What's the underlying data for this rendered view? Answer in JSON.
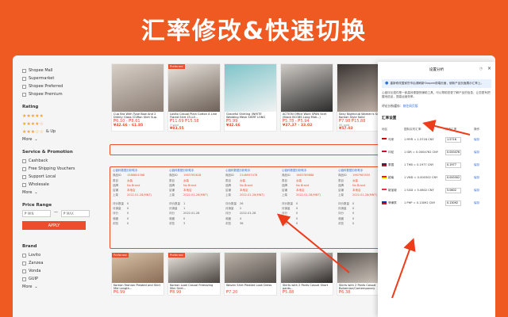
{
  "banner": {
    "title": "汇率修改&快速切换"
  },
  "sidebar": {
    "shops": [
      "Shopee Mall",
      "Supermarket",
      "Shopee Preferred",
      "Shopee Premium"
    ],
    "rating_title": "Rating",
    "rating_and_up": "& Up",
    "rating_more": "More",
    "service_title": "Service & Promotion",
    "services": [
      "Cashback",
      "Free Shipping Vouchers",
      "Support Local",
      "Wholesale"
    ],
    "service_more": "More",
    "price_title": "Price Range",
    "min_placeholder": "₱ MIN",
    "max_placeholder": "₱ MAX",
    "apply": "APPLY",
    "brand_title": "Brand",
    "brands": [
      "Lovito",
      "Zanzea",
      "Vonda",
      "GUIP"
    ],
    "brand_more": "More"
  },
  "products": [
    {
      "name": "Cup Bra With Type Bow And 2 Dimity Glass Chiffon Skirt Sup.",
      "price": "₱6.10 - ₱8.61",
      "sold": "",
      "converted": "¥42.66 - 61.85",
      "badge": ""
    },
    {
      "name": "Lovito Casual Plain Cotton A Line Flared Skirt LT-LLY...",
      "price": "₱11.69 ₱15.58",
      "sold": "7 sold",
      "converted": "¥83.55",
      "badge": "Preferred"
    },
    {
      "name": "Graceful Shirting (WHITE Wedding Mesh SHIRT LONG Shirt...)",
      "price": "₱5.99",
      "sold": "",
      "converted": "¥42.66",
      "badge": ""
    },
    {
      "name": "ACTION Office Work SPAN Skirt (Black BCGBS Long Midi...)",
      "price": "₱5.78 - ₱5.94",
      "sold": "",
      "converted": "¥37.37 - 33.02",
      "badge": ""
    },
    {
      "name": "Sexy Nightclub Women's Summer Korean Style Solid",
      "price": "₱7.98 ₱15.88",
      "sold": "95 sold",
      "converted": "¥57.03",
      "badge": ""
    }
  ],
  "plugin_info": [
    {
      "title": "心链科数据分析助手",
      "rows": [
        [
          "商品ID",
          "1588804368"
        ],
        [
          "类目",
          "女装"
        ],
        [
          "品牌",
          "No Brand"
        ],
        [
          "店铺",
          "本地店"
        ],
        [
          "上架",
          "2022-01-28(MNT)"
        ],
        [
          "评价数量",
          "0"
        ],
        [
          "月销量",
          "0"
        ],
        [
          "评分",
          "0"
        ],
        [
          "收藏",
          "0"
        ],
        [
          "浏览",
          "0"
        ]
      ]
    },
    {
      "title": "心链科数据分析助手",
      "rows": [
        [
          "商品ID",
          "1963785818"
        ],
        [
          "类目",
          "女装"
        ],
        [
          "品牌",
          "No Brand"
        ],
        [
          "店铺",
          "本地店"
        ],
        [
          "上架",
          "2022-01-28(MNT)"
        ],
        [
          "评价数量",
          "1"
        ],
        [
          "月销量",
          "1"
        ],
        [
          "评分",
          "2022-01-28"
        ],
        [
          "收藏",
          "0"
        ],
        [
          "浏览",
          "3"
        ]
      ]
    },
    {
      "title": "心链科数据分析助手",
      "rows": [
        [
          "商品ID",
          "2148957478"
        ],
        [
          "类目",
          "女装"
        ],
        [
          "品牌",
          "No Brand"
        ],
        [
          "店铺",
          "本地店"
        ],
        [
          "上架",
          "2022-01-28(MNT)"
        ],
        [
          "评价数量",
          "26"
        ],
        [
          "月销量",
          "2"
        ],
        [
          "评分",
          "2022-01-28"
        ],
        [
          "收藏",
          "4"
        ],
        [
          "浏览",
          "36"
        ]
      ]
    },
    {
      "title": "心链科数据分析助手",
      "rows": [
        [
          "商品ID",
          "1663789888"
        ],
        [
          "类目",
          "女装"
        ],
        [
          "品牌",
          "No Brand"
        ],
        [
          "店铺",
          "本地店"
        ],
        [
          "上架",
          "2022-01-28(MNT)"
        ],
        [
          "评价数量",
          "0"
        ],
        [
          "月销量",
          "0"
        ],
        [
          "评分",
          "0"
        ],
        [
          "收藏",
          "0"
        ],
        [
          "浏览",
          "0"
        ]
      ]
    },
    {
      "title": "心链科数据分析助手",
      "rows": [
        [
          "商品ID",
          "1967983555"
        ],
        [
          "类目",
          "女装"
        ],
        [
          "品牌",
          "No Brand"
        ],
        [
          "店铺",
          "本地店"
        ],
        [
          "上架",
          "2022-01-28(MNT)"
        ],
        [
          "评价数量",
          "0"
        ],
        [
          "月销量",
          "0"
        ],
        [
          "评分",
          "0"
        ],
        [
          "收藏",
          "0"
        ],
        [
          "浏览",
          "0"
        ]
      ]
    }
  ],
  "row2": [
    {
      "name": "Korean Fashion Pleated and Skirt Mid Length...",
      "price": "₱6.99",
      "badge": "Preferred"
    },
    {
      "name": "Korean Look Casual Freesizing Mini Skirt...",
      "price": "₱8.99",
      "badge": "Preferred"
    },
    {
      "name": "Woven Shirt Pleated Look Dress",
      "price": "₱7.20",
      "badge": ""
    },
    {
      "name": "Skirts with 2 Pants Casual Short pants...",
      "price": "₱5.88",
      "badge": ""
    },
    {
      "name": "Skirts with 2 Pants Casual Bohemian/Contemporary",
      "price": "₱6.38",
      "badge": ""
    }
  ],
  "panel": {
    "title": "设置分析",
    "notice": "重新修改国家货币后请刷新Shopee前端页面，使新产品页面展示汇率上。",
    "desc": "心链评论插件是一款高效便捷的辅助工具，可以帮助您更了解产品的信息，让您更有把握地选品，提高运营效率。",
    "folder_label": "评论分析缓存：",
    "folder_link": "前往网页版",
    "section": "汇率设置",
    "headers": [
      "地区",
      "国际实时汇率",
      "设定汇率",
      "操作"
    ],
    "rows": [
      {
        "region": "马来",
        "rate": "1 MYR = 1.5716 CNY",
        "custom": "1.5716",
        "action": "保存"
      },
      {
        "region": "印尼",
        "rate": "1 IDR = 0.0004762 CNY",
        "custom": "0.0004762",
        "action": "保存"
      },
      {
        "region": "泰国",
        "rate": "1 THB = 0.1977 CNY",
        "custom": "0.1977",
        "action": "保存"
      },
      {
        "region": "越南",
        "rate": "1 VND = 0.000302 CNY",
        "custom": "0.000302",
        "action": "保存"
      },
      {
        "region": "新加坡",
        "rate": "1 SGD = 5.0602 CNY",
        "custom": "5.0602",
        "action": "保存"
      },
      {
        "region": "菲律宾",
        "rate": "1 PHP = 0.13092 CNY",
        "custom": "0.13092",
        "action": "保存"
      }
    ]
  },
  "colors": {
    "accent": "#ef5a22",
    "shopee": "#ee4d2d",
    "link": "#2f6fdf"
  }
}
